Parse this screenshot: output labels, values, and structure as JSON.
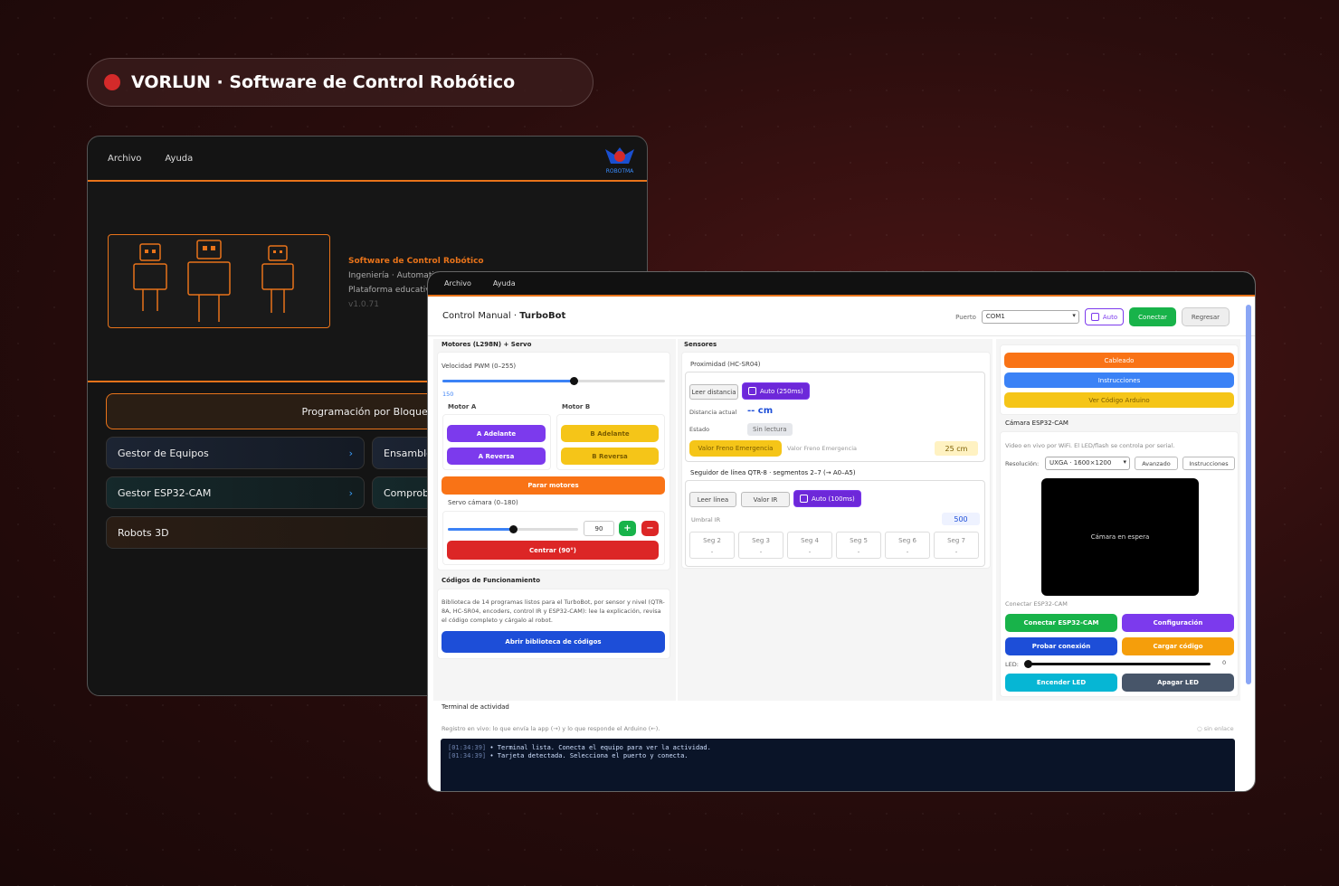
{
  "banner": {
    "title": "VORLUN · Software de Control Robótico"
  },
  "back_window": {
    "menu": [
      "Archivo",
      "Ayuda"
    ],
    "logo_text": "ROBOTMA",
    "hero_title": "Software de Control Robótico",
    "hero_line1": "Ingeniería · Automatiz",
    "hero_line2": "Plataforma educativa",
    "version": "v1.0.71",
    "prog_button": "Programación por Bloques",
    "cards": {
      "gestor_equipos": "Gestor de Equipos",
      "ensamble": "Ensamble",
      "gestor_esp32": "Gestor ESP32-CAM",
      "comproba": "Comproba",
      "robots3d": "Robots 3D"
    }
  },
  "front_window": {
    "menu": [
      "Archivo",
      "Ayuda"
    ],
    "title_prefix": "Control Manual · ",
    "title_robot": "TurboBot",
    "port_label": "Puerto",
    "port_value": "COM1",
    "auto_label": "Auto",
    "connect_label": "Conectar",
    "back_label": "Regresar",
    "motors": {
      "section": "Motores (L298N) + Servo",
      "pwm_label": "Velocidad PWM (0–255)",
      "pwm_value": "150",
      "pwm_fraction": 0.59,
      "motor_a": "Motor A",
      "motor_b": "Motor B",
      "a_forward": "A Adelante",
      "a_reverse": "A Reversa",
      "b_forward": "B Adelante",
      "b_reverse": "B Reversa",
      "stop": "Parar motores",
      "servo_label": "Servo cámara (0–180)",
      "servo_value": "90",
      "servo_fraction": 0.5,
      "plus": "+",
      "minus": "−",
      "center": "Centrar (90°)"
    },
    "codes": {
      "section": "Códigos de Funcionamiento",
      "desc": "Biblioteca de 14 programas listos para el TurboBot, por sensor y nivel (QTR-8A, HC-SR04, encoders, control IR y ESP32-CAM): lee la explicación, revisa el código completo y cárgalo al robot.",
      "open_library": "Abrir biblioteca de códigos"
    },
    "sensors": {
      "section": "Sensores",
      "prox_title": "Proximidad (HC-SR04)",
      "read_distance": "Leer distancia",
      "auto_250": "Auto (250ms)",
      "dist_label": "Distancia actual",
      "dist_value": "-- cm",
      "state_label": "Estado",
      "state_value": "Sin lectura",
      "brake_button": "Valor Freno Emergencia",
      "brake_label": "Valor Freno Emergencia",
      "brake_value": "25 cm",
      "line_title": "Seguidor de línea QTR-8 · segmentos 2–7 (→ A0–A5)",
      "read_line": "Leer línea",
      "ir_value_btn": "Valor IR",
      "auto_100": "Auto (100ms)",
      "ir_threshold_label": "Umbral IR",
      "ir_threshold_value": "500",
      "segments": [
        {
          "name": "Seg 2",
          "value": "-"
        },
        {
          "name": "Seg 3",
          "value": "-"
        },
        {
          "name": "Seg 4",
          "value": "-"
        },
        {
          "name": "Seg 5",
          "value": "-"
        },
        {
          "name": "Seg 6",
          "value": "-"
        },
        {
          "name": "Seg 7",
          "value": "-"
        }
      ]
    },
    "right": {
      "wiring": "Cableado",
      "instructions": "Instrucciones",
      "arduino_code": "Ver Código Arduino",
      "camera_section": "Cámara ESP32-CAM",
      "camera_desc": "Video en vivo por WiFi. El LED/flash se controla por serial.",
      "resolution_label": "Resolución:",
      "resolution_value": "UXGA · 1600×1200",
      "advanced": "Avanzado",
      "instr_small": "Instrucciones",
      "camera_idle": "Cámara en espera",
      "connect_esp_label": "Conectar ESP32-CAM",
      "connect_esp": "Conectar ESP32-CAM",
      "configuration": "Configuración",
      "test_connection": "Probar conexión",
      "load_code": "Cargar código",
      "led_label": "LED:",
      "led_value": "0",
      "led_fraction": 0,
      "led_on": "Encender LED",
      "led_off": "Apagar LED"
    },
    "terminal": {
      "section": "Terminal de actividad",
      "desc": "Registro en vivo: lo que envía la app (→) y lo que responde el Arduino (←).",
      "link_status": "○ sin enlace",
      "lines": [
        {
          "time": "[01:34:39]",
          "text": " • Terminal lista. Conecta el equipo para ver la actividad."
        },
        {
          "time": "[01:34:39]",
          "text": " • Tarjeta detectada. Selecciona el puerto y conecta."
        }
      ]
    }
  },
  "colors": {
    "orange": "#e8731a",
    "purple": "#7c3aed",
    "yellow": "#f5c518",
    "red": "#dc2626",
    "green": "#18b34a",
    "blue": "#1d4ed8",
    "cyan": "#06b6d4",
    "slate": "#475569"
  }
}
